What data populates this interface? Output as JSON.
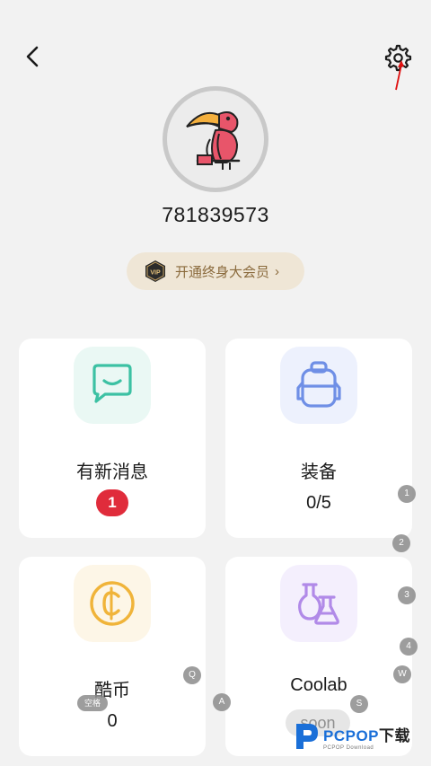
{
  "profile": {
    "user_id": "781839573",
    "vip_label": "开通终身大会员",
    "vip_badge_text": "VIP"
  },
  "cards": {
    "messages": {
      "title": "有新消息",
      "badge": "1"
    },
    "equipment": {
      "title": "装备",
      "value": "0/5"
    },
    "coins": {
      "title": "酷币",
      "value": "0"
    },
    "coolab": {
      "title": "Coolab",
      "status": "soon"
    }
  },
  "keyboard_hints": {
    "k1": "1",
    "k2": "2",
    "k3": "3",
    "k4": "4",
    "q": "Q",
    "w": "W",
    "a": "A",
    "s": "S",
    "space": "空格"
  },
  "watermark": {
    "brand": "PCPOP",
    "suffix": "下载",
    "sub": "PCPOP Download"
  },
  "colors": {
    "background": "#f2f2f2",
    "card": "#ffffff",
    "vip_pill": "#efe6d6",
    "vip_text": "#8a6a3c",
    "badge_red": "#e02c3b",
    "messages_icon_bg": "#eaf8f4",
    "messages_icon": "#3cc1a3",
    "equipment_icon_bg": "#edf1fd",
    "equipment_icon": "#6f8fe6",
    "coins_icon_bg": "#fdf6e7",
    "coins_icon": "#f0b43a",
    "coolab_icon_bg": "#f4effd",
    "coolab_icon": "#b18ae8",
    "annotation_arrow": "#e01010"
  },
  "icons": {
    "back": "back-arrow-icon",
    "settings": "gear-icon",
    "avatar": "toucan-avatar",
    "messages": "chat-bubble-icon",
    "equipment": "backpack-icon",
    "coins": "coin-icon",
    "coolab": "flask-icon"
  }
}
